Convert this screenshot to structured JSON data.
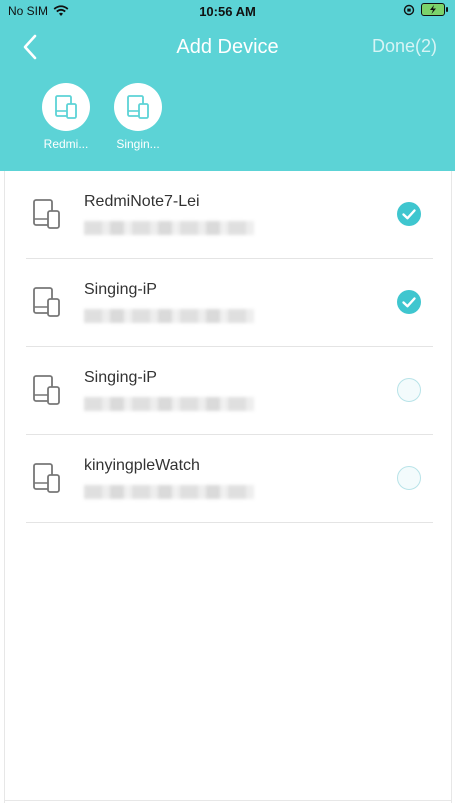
{
  "status": {
    "carrier": "No SIM",
    "time": "10:56 AM"
  },
  "nav": {
    "title": "Add Device",
    "done": "Done(2)"
  },
  "selected": [
    {
      "label": "Redmi..."
    },
    {
      "label": "Singin..."
    }
  ],
  "devices": [
    {
      "name": "RedmiNote7-Lei",
      "checked": true
    },
    {
      "name": "Singing-iP",
      "checked": true
    },
    {
      "name": "Singing-iP",
      "checked": false
    },
    {
      "name": "kinyingpleWatch",
      "checked": false
    }
  ],
  "colors": {
    "header": "#5cd3d6",
    "check": "#3fc6cf"
  },
  "icons": {
    "back": "chevron-left-icon",
    "device": "devices-icon",
    "check": "checkmark-icon"
  }
}
